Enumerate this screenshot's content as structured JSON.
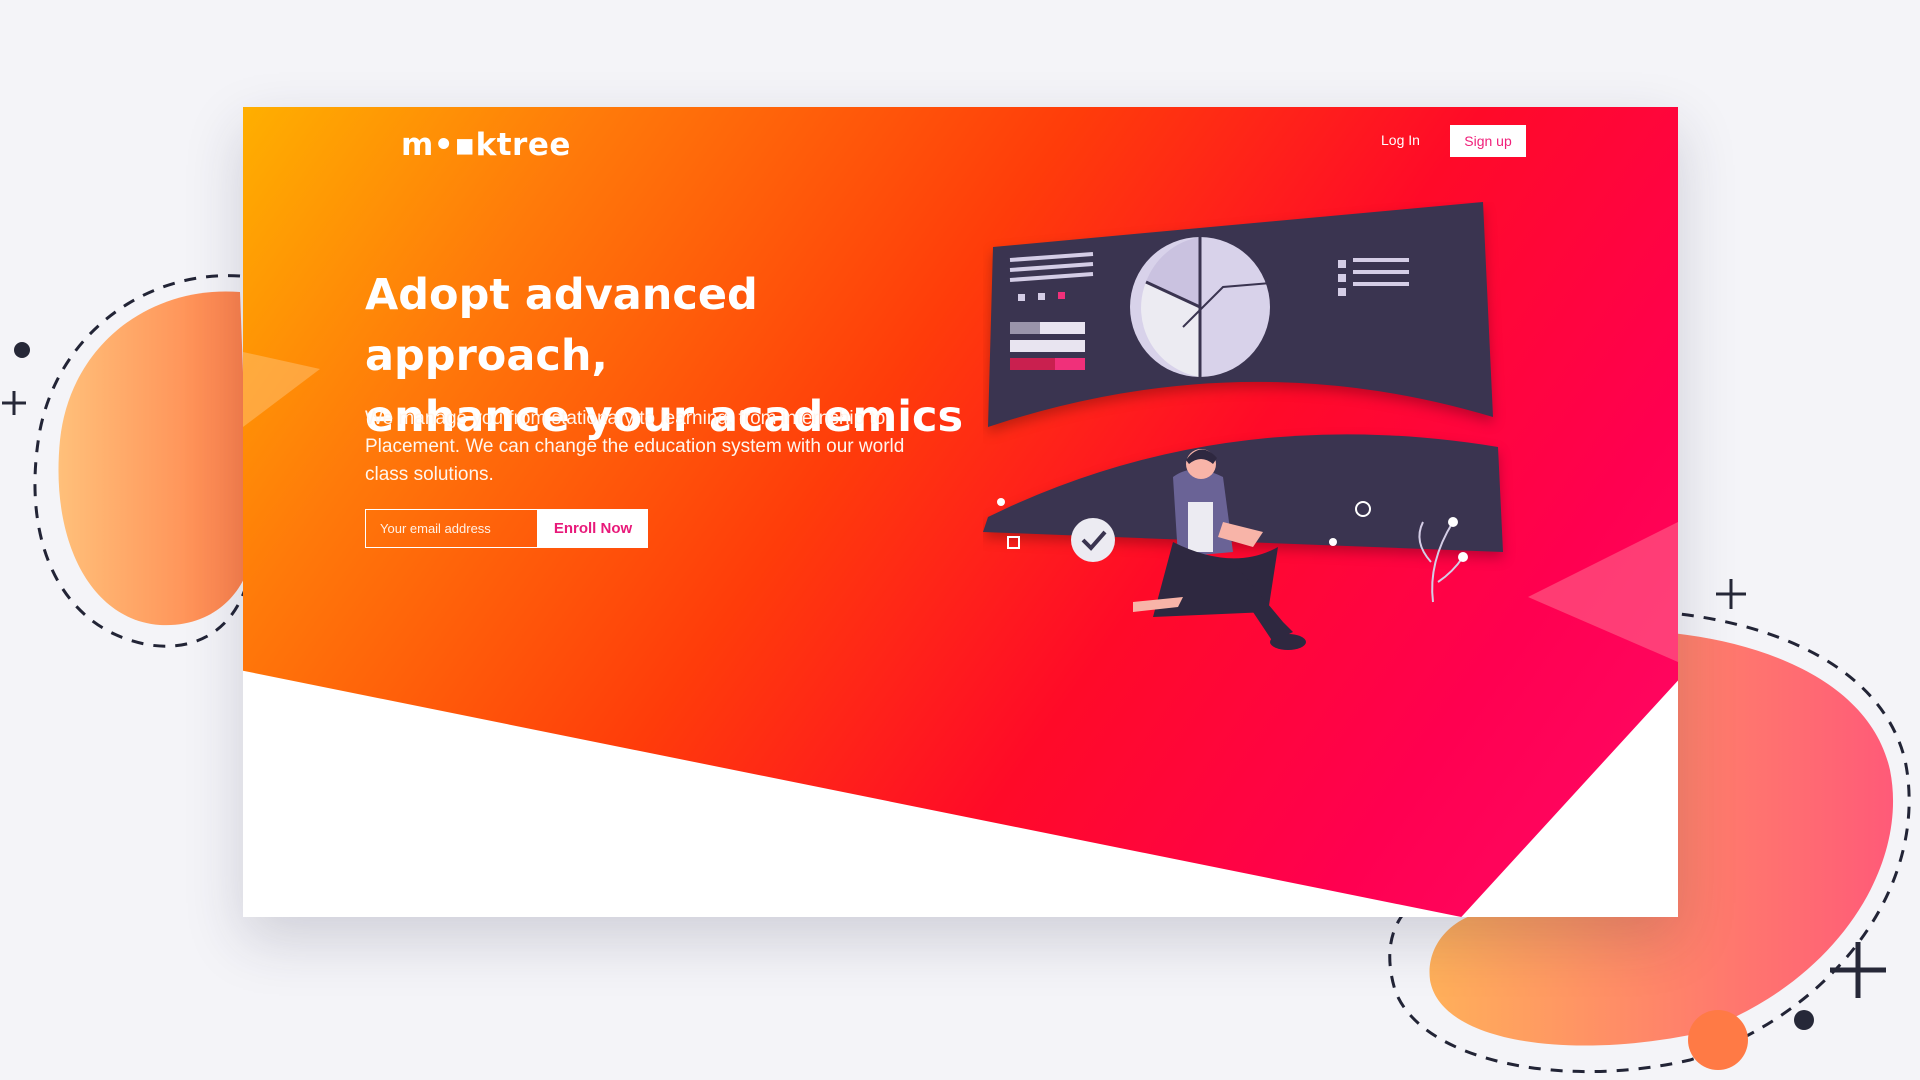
{
  "brand": {
    "logo_text": "m•▪ktree"
  },
  "nav": {
    "login_label": "Log In",
    "signup_label": "Sign up"
  },
  "hero": {
    "headline_line1": "Adopt advanced approach,",
    "headline_line2": "enhance your academics",
    "subtext": "We manage you from stationary to learning, from internship to Placement. We can change the education system with our world class solutions.",
    "email_placeholder": "Your email address",
    "enroll_label": "Enroll Now"
  },
  "colors": {
    "gradient_start": "#ffaf00",
    "gradient_mid": "#ff3c0a",
    "gradient_end": "#ff0050",
    "accent_pink": "#e8197a",
    "screen_dark": "#3a3450",
    "blob_orange": "#ff9a3c",
    "blob_pink": "#ff5a6e"
  },
  "icons": [
    "checkmark-icon",
    "leaf-plant-icon",
    "pie-chart-icon",
    "plus-icon",
    "dot-icon"
  ]
}
